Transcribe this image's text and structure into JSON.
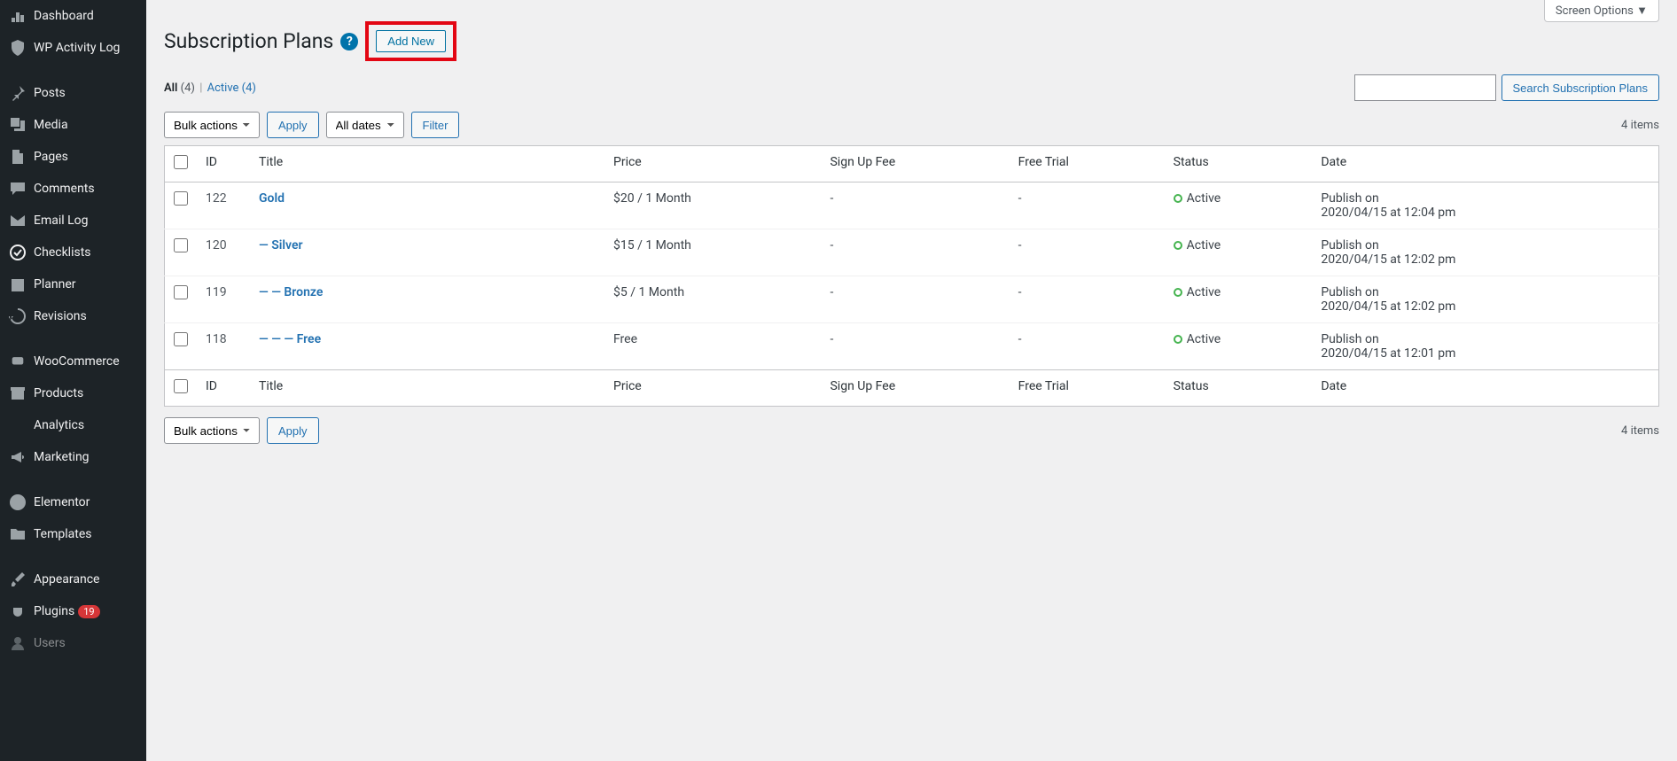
{
  "sidebar": {
    "items": [
      {
        "label": "Dashboard",
        "icon": "dashboard"
      },
      {
        "label": "WP Activity Log",
        "icon": "shield"
      },
      {
        "label": "Posts",
        "icon": "pin"
      },
      {
        "label": "Media",
        "icon": "media"
      },
      {
        "label": "Pages",
        "icon": "pages"
      },
      {
        "label": "Comments",
        "icon": "comments"
      },
      {
        "label": "Email Log",
        "icon": "email"
      },
      {
        "label": "Checklists",
        "icon": "check"
      },
      {
        "label": "Planner",
        "icon": "calendar"
      },
      {
        "label": "Revisions",
        "icon": "backup"
      },
      {
        "label": "WooCommerce",
        "icon": "woo"
      },
      {
        "label": "Products",
        "icon": "archive"
      },
      {
        "label": "Analytics",
        "icon": "chart"
      },
      {
        "label": "Marketing",
        "icon": "megaphone"
      },
      {
        "label": "Elementor",
        "icon": "elementor"
      },
      {
        "label": "Templates",
        "icon": "folder"
      },
      {
        "label": "Appearance",
        "icon": "brush"
      },
      {
        "label": "Plugins",
        "icon": "plugin",
        "badge": "19"
      },
      {
        "label": "Users",
        "icon": "users"
      }
    ]
  },
  "header": {
    "screen_options": "Screen Options",
    "title": "Subscription Plans",
    "add_new": "Add New"
  },
  "subsub": {
    "all_label": "All",
    "all_count": "(4)",
    "sep": "|",
    "active_label": "Active",
    "active_count": "(4)"
  },
  "search": {
    "button": "Search Subscription Plans"
  },
  "actions": {
    "bulk": "Bulk actions",
    "apply": "Apply",
    "dates": "All dates",
    "filter": "Filter"
  },
  "item_count": "4 items",
  "columns": {
    "id": "ID",
    "title": "Title",
    "price": "Price",
    "signup": "Sign Up Fee",
    "trial": "Free Trial",
    "status": "Status",
    "date": "Date"
  },
  "rows": [
    {
      "id": "122",
      "title": "Gold",
      "price": "$20 / 1 Month",
      "signup": "-",
      "trial": "-",
      "status": "Active",
      "date1": "Publish on",
      "date2": "2020/04/15 at 12:04 pm"
    },
    {
      "id": "120",
      "title": "— Silver",
      "price": "$15 / 1 Month",
      "signup": "-",
      "trial": "-",
      "status": "Active",
      "date1": "Publish on",
      "date2": "2020/04/15 at 12:02 pm"
    },
    {
      "id": "119",
      "title": "— — Bronze",
      "price": "$5 / 1 Month",
      "signup": "-",
      "trial": "-",
      "status": "Active",
      "date1": "Publish on",
      "date2": "2020/04/15 at 12:02 pm"
    },
    {
      "id": "118",
      "title": "— — — Free",
      "price": "Free",
      "signup": "-",
      "trial": "-",
      "status": "Active",
      "date1": "Publish on",
      "date2": "2020/04/15 at 12:01 pm"
    }
  ]
}
